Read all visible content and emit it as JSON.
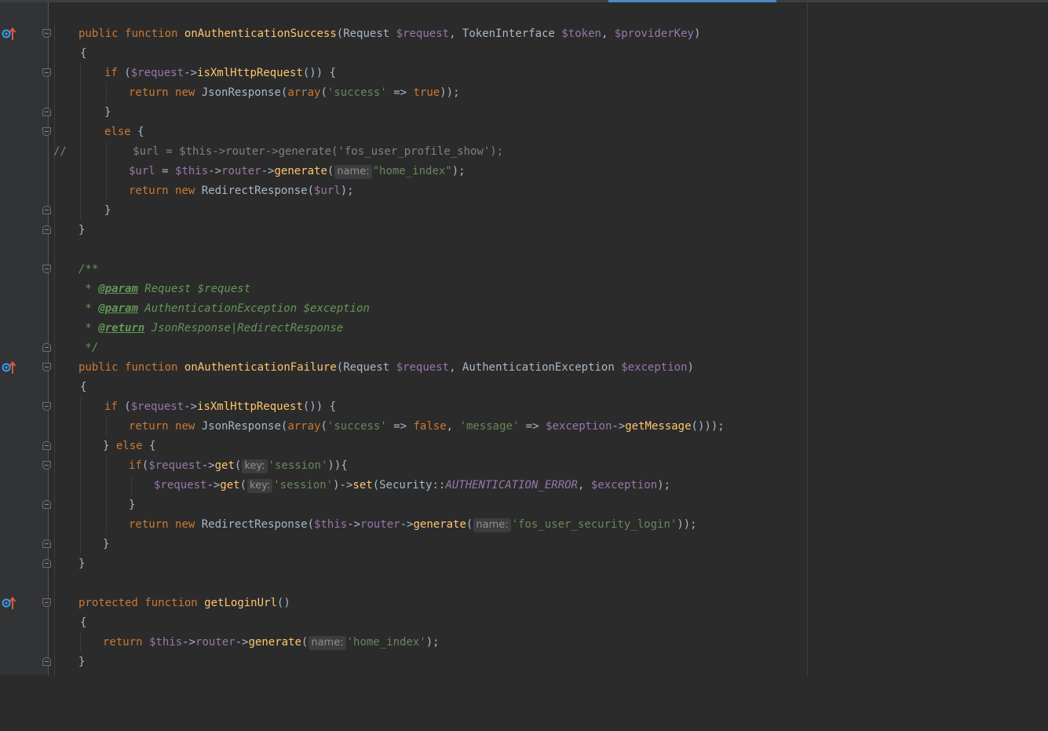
{
  "editor": {
    "language": "PHP",
    "colors": {
      "background": "#2b2b2b",
      "gutter": "#313335",
      "keyword": "#cc7832",
      "function": "#ffc66d",
      "variable": "#9876aa",
      "string": "#6a8759",
      "doc_comment": "#629755",
      "active_tab": "#4a88c7"
    },
    "gutter_icons": [
      "override-method-icon",
      "fold-marker-icon"
    ],
    "code": {
      "l1": {
        "kw1": "public",
        "kw2": "function",
        "fn": "onAuthenticationSuccess",
        "p1": "(Request ",
        "v1": "$request",
        "p2": ", TokenInterface ",
        "v2": "$token",
        "p3": ", ",
        "v3": "$providerKey",
        "p4": ")"
      },
      "l2": {
        "t": "{"
      },
      "l3": {
        "kw": "if",
        "p1": " (",
        "v1": "$request",
        "p2": "->",
        "fn": "isXmlHttpRequest",
        "p3": "()) {"
      },
      "l4": {
        "kw1": "return",
        "kw2": "new",
        "p1": " JsonResponse(",
        "kw3": "array",
        "p2": "(",
        "s1": "'success'",
        "p3": " => ",
        "kw4": "true",
        "p4": "));"
      },
      "l5": {
        "t": "}"
      },
      "l6": {
        "kw": "else",
        "p1": " {"
      },
      "l7": {
        "t": "//          $url = $this->router->generate('fos_user_profile_show');"
      },
      "l8": {
        "v1": "$url",
        "p1": " = ",
        "v2": "$this",
        "p2": "->",
        "v3": "router",
        "p3": "->",
        "fn": "generate",
        "p4": "(",
        "hint": "name:",
        "s1": "\"home_index\"",
        "p5": ");"
      },
      "l9": {
        "kw1": "return",
        "kw2": "new",
        "p1": " RedirectResponse(",
        "v1": "$url",
        "p2": ");"
      },
      "l10": {
        "t": "}"
      },
      "l11": {
        "t": "}"
      },
      "l13": {
        "t": "/**"
      },
      "l14": {
        "star": " * ",
        "tag": "@param",
        "rest": " Request $request"
      },
      "l15": {
        "star": " * ",
        "tag": "@param",
        "rest": " AuthenticationException $exception"
      },
      "l16": {
        "star": " * ",
        "tag": "@return",
        "rest": " JsonResponse|RedirectResponse"
      },
      "l17": {
        "t": " */"
      },
      "l18": {
        "kw1": "public",
        "kw2": "function",
        "fn": "onAuthenticationFailure",
        "p1": "(Request ",
        "v1": "$request",
        "p2": ", AuthenticationException ",
        "v2": "$exception",
        "p3": ")"
      },
      "l19": {
        "t": "{"
      },
      "l20": {
        "kw": "if",
        "p1": " (",
        "v1": "$request",
        "p2": "->",
        "fn": "isXmlHttpRequest",
        "p3": "()) {"
      },
      "l21": {
        "kw1": "return",
        "kw2": "new",
        "p1": " JsonResponse(",
        "kw3": "array",
        "p2": "(",
        "s1": "'success'",
        "p3": " => ",
        "kw4": "false",
        "p4": ", ",
        "s2": "'message'",
        "p5": " => ",
        "v1": "$exception",
        "p6": "->",
        "fn": "getMessage",
        "p7": "()));"
      },
      "l22": {
        "p1": "} ",
        "kw": "else",
        "p2": " {"
      },
      "l23": {
        "kw": "if",
        "p1": "(",
        "v1": "$request",
        "p2": "->",
        "fn": "get",
        "p3": "(",
        "hint": "key:",
        "s1": "'session'",
        "p4": ")){"
      },
      "l24": {
        "v1": "$request",
        "p1": "->",
        "fn1": "get",
        "p2": "(",
        "hint": "key:",
        "s1": "'session'",
        "p3": ")->",
        "fn2": "set",
        "p4": "(Security::",
        "cst": "AUTHENTICATION_ERROR",
        "p5": ", ",
        "v2": "$exception",
        "p6": ");"
      },
      "l25": {
        "t": "}"
      },
      "l26": {
        "kw1": "return",
        "kw2": "new",
        "p1": " RedirectResponse(",
        "v1": "$this",
        "p2": "->",
        "v2": "router",
        "p3": "->",
        "fn": "generate",
        "p4": "(",
        "hint": "name:",
        "s1": "'fos_user_security_login'",
        "p5": "));"
      },
      "l27": {
        "t": "}"
      },
      "l28": {
        "t": "}"
      },
      "l30": {
        "kw1": "protected",
        "kw2": "function",
        "fn": "getLoginUrl",
        "p1": "()"
      },
      "l31": {
        "t": "{"
      },
      "l32": {
        "kw": "return",
        "p0": " ",
        "v1": "$this",
        "p1": "->",
        "v2": "router",
        "p2": "->",
        "fn": "generate",
        "p3": "(",
        "hint": "name:",
        "s1": "'home_index'",
        "p4": ");"
      },
      "l33": {
        "t": "}"
      }
    }
  }
}
